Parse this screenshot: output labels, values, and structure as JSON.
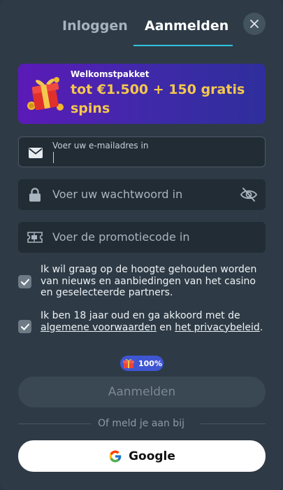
{
  "tabs": {
    "login": "Inloggen",
    "register": "Aanmelden"
  },
  "colors": {
    "accent": "#2ec5e0",
    "banner_title": "#f5c84c",
    "badge": "#3f56d3"
  },
  "banner": {
    "kicker": "Welkomstpakket",
    "title": "tot €1.500 + 150 gratis spins",
    "icon": "gift-icon"
  },
  "fields": {
    "email": {
      "label": "Voer uw e-mailadres in",
      "value": "",
      "icon": "envelope-icon"
    },
    "password": {
      "placeholder": "Voer uw wachtwoord in",
      "icon": "lock-icon",
      "toggle_icon": "eye-off-icon"
    },
    "promo": {
      "placeholder": "Voer de promotiecode in",
      "icon": "ticket-icon"
    }
  },
  "consents": {
    "news": {
      "checked": true,
      "text": "Ik wil graag op de hoogte gehouden worden van nieuws en aanbiedingen van het casino en geselecteerde partners."
    },
    "terms": {
      "checked": true,
      "text_before": "Ik ben 18 jaar oud en ga akkoord met de ",
      "link_terms": "algemene voorwaarden",
      "text_middle": " en ",
      "link_privacy": "het privacybeleid",
      "text_after": "."
    }
  },
  "badge": {
    "text": "100%",
    "icon": "gift-icon"
  },
  "submit": {
    "label": "Aanmelden"
  },
  "divider": {
    "text": "Of meld je aan bij"
  },
  "google": {
    "label": "Google",
    "icon": "google-icon"
  }
}
